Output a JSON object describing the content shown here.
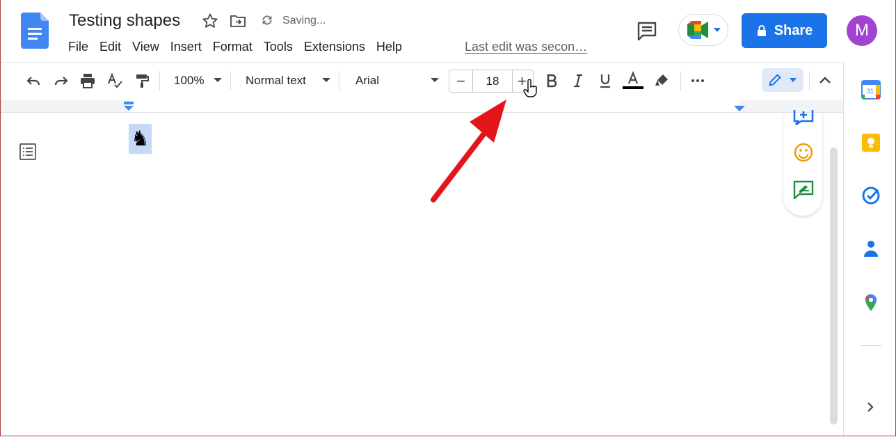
{
  "document": {
    "title": "Testing shapes",
    "status": "Saving...",
    "last_edit": "Last edit was secon…"
  },
  "menu": [
    "File",
    "Edit",
    "View",
    "Insert",
    "Format",
    "Tools",
    "Extensions",
    "Help"
  ],
  "header": {
    "share_label": "Share",
    "avatar_initial": "M"
  },
  "toolbar": {
    "zoom": "100%",
    "style": "Normal text",
    "font": "Arial",
    "font_size": "18",
    "minus": "−",
    "plus": "+"
  },
  "content": {
    "selected_glyph": "♞"
  },
  "colors": {
    "accent": "#1a73e8",
    "avatar": "#a142d1",
    "selection": "#c5d8f7",
    "annotation_arrow": "#e3151b"
  },
  "icons": [
    "docs-logo-icon",
    "star-icon",
    "move-to-folder-icon",
    "saving-sync-icon",
    "comment-history-icon",
    "meet-icon",
    "lock-icon",
    "undo-icon",
    "redo-icon",
    "print-icon",
    "spellcheck-icon",
    "paint-format-icon",
    "bold-icon",
    "italic-icon",
    "underline-icon",
    "text-color-icon",
    "highlight-icon",
    "more-icon",
    "editing-mode-icon",
    "collapse-icon",
    "outline-icon",
    "add-comment-icon",
    "emoji-reaction-icon",
    "suggest-edits-icon",
    "calendar-icon",
    "keep-icon",
    "tasks-icon",
    "contacts-icon",
    "maps-icon",
    "expand-panel-icon"
  ]
}
